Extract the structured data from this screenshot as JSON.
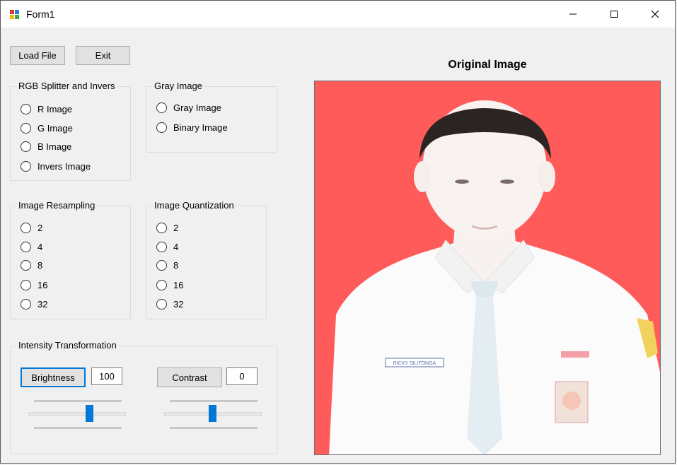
{
  "window": {
    "title": "Form1"
  },
  "toolbar": {
    "load_file_label": "Load File",
    "exit_label": "Exit"
  },
  "rgb_group": {
    "title": "RGB Splitter and Invers",
    "options": [
      "R Image",
      "G Image",
      "B Image",
      "Invers Image"
    ]
  },
  "gray_group": {
    "title": "Gray Image",
    "options": [
      "Gray Image",
      "Binary Image"
    ]
  },
  "resampling_group": {
    "title": "Image Resampling",
    "options": [
      "2",
      "4",
      "8",
      "16",
      "32"
    ]
  },
  "quantization_group": {
    "title": "Image Quantization",
    "options": [
      "2",
      "4",
      "8",
      "16",
      "32"
    ]
  },
  "intensity_group": {
    "title": "Intensity Transformation",
    "brightness_label": "Brightness",
    "brightness_value": "100",
    "contrast_label": "Contrast",
    "contrast_value": "0",
    "brightness_slider_level": 0.65,
    "contrast_slider_level": 0.5
  },
  "image_panel": {
    "caption": "Original Image",
    "name_tag_text": "RICKY SILITONGA"
  },
  "colors": {
    "accent": "#0078d7",
    "photo_background": "#ff5b5b"
  },
  "icons": {
    "app": "form-app-icon",
    "minimize": "minimize-icon",
    "maximize": "maximize-icon",
    "close": "close-icon"
  }
}
